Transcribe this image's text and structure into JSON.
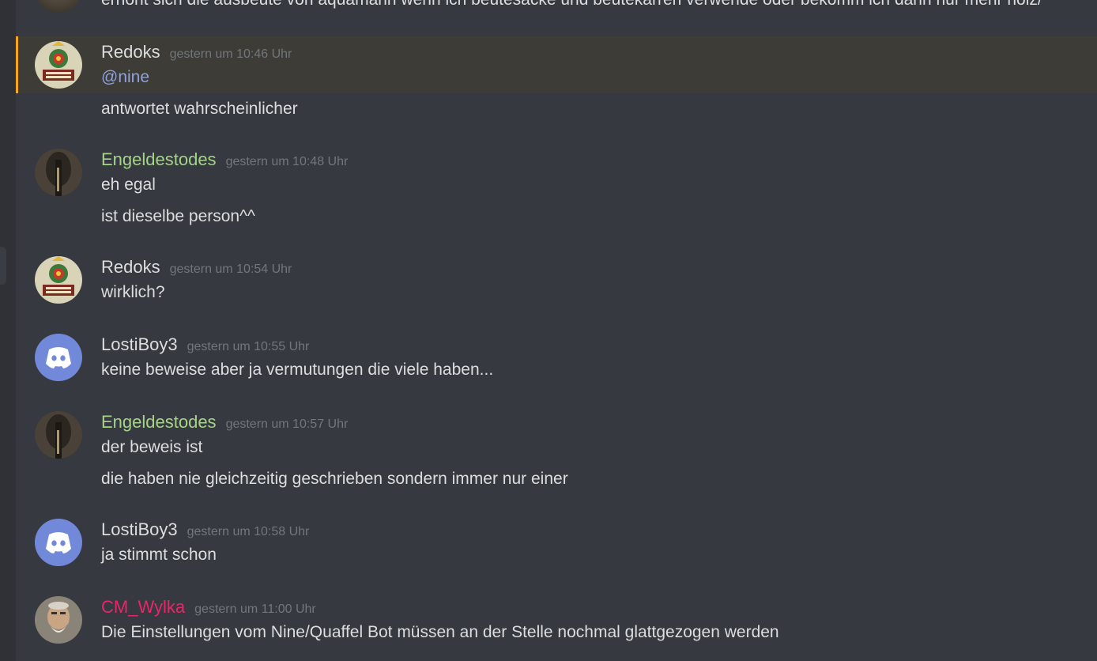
{
  "partial_top_line": "erhöht sich die ausbeute von aquamarin wenn ich beutesäcke und beutekarren verwende oder bekomm ich dann nur mehr holz/",
  "colors": {
    "background": "#36393f",
    "text": "#dcddde",
    "timestamp": "#72767d",
    "mention": "#8ea1e1",
    "highlight_bar": "#faa61a",
    "redoks": "#dcddde",
    "engeldestodes": "#a5d489",
    "lostiboy3": "#dcddde",
    "cm_wylka": "#e9266a"
  },
  "groups": [
    {
      "username": "Redoks",
      "timestamp": "gestern um 10:46 Uhr",
      "avatar": "snail-avatar",
      "lines": [
        "@nine",
        "antwortet wahrscheinlicher"
      ]
    },
    {
      "username": "Engeldestodes",
      "timestamp": "gestern um 10:48 Uhr",
      "avatar": "dark-figure-avatar",
      "lines": [
        "eh egal",
        "ist dieselbe person^^"
      ]
    },
    {
      "username": "Redoks",
      "timestamp": "gestern um 10:54 Uhr",
      "avatar": "snail-avatar",
      "lines": [
        "wirklich?"
      ]
    },
    {
      "username": "LostiBoy3",
      "timestamp": "gestern um 10:55 Uhr",
      "avatar": "discord-default-avatar",
      "lines": [
        "keine beweise aber ja vermutungen die viele haben..."
      ]
    },
    {
      "username": "Engeldestodes",
      "timestamp": "gestern um 10:57 Uhr",
      "avatar": "dark-figure-avatar",
      "lines": [
        "der beweis ist",
        "die haben nie gleichzeitig geschrieben sondern immer nur einer"
      ]
    },
    {
      "username": "LostiBoy3",
      "timestamp": "gestern um 10:58 Uhr",
      "avatar": "discord-default-avatar",
      "lines": [
        "ja stimmt schon"
      ]
    },
    {
      "username": "CM_Wylka",
      "timestamp": "gestern um 11:00 Uhr",
      "avatar": "bearded-man-avatar",
      "lines": [
        "Die Einstellungen vom Nine/Quaffel Bot müssen an der Stelle nochmal glattgezogen werden"
      ]
    }
  ]
}
